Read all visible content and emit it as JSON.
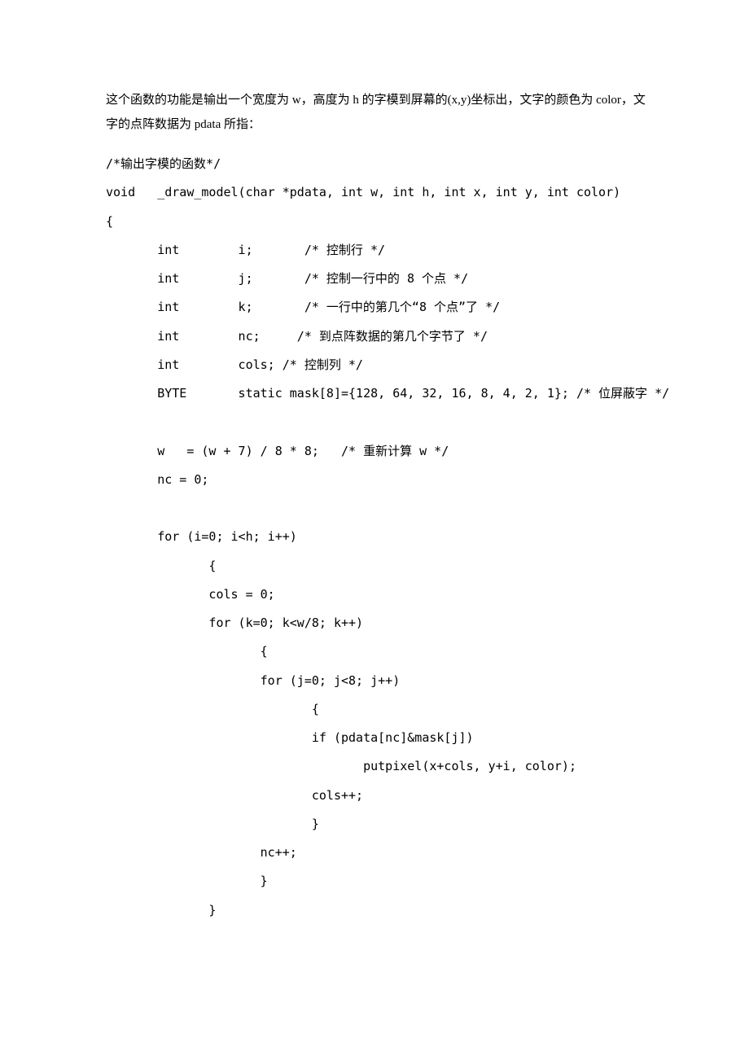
{
  "intro": {
    "p1": "这个函数的功能是输出一个宽度为 w，高度为 h 的字模到屏幕的(x,y)坐标出，文字的颜色为 color，文字的点阵数据为 pdata 所指："
  },
  "code": {
    "l01": "/*输出字模的函数*/",
    "l02": "void   _draw_model(char *pdata, int w, int h, int x, int y, int color)",
    "l03": "{",
    "l04": "       int        i;       /* 控制行 */",
    "l05": "       int        j;       /* 控制一行中的 8 个点 */",
    "l06": "       int        k;       /* 一行中的第几个“8 个点”了 */",
    "l07": "       int        nc;     /* 到点阵数据的第几个字节了 */",
    "l08": "       int        cols; /* 控制列 */",
    "l09": "       BYTE       static mask[8]={128, 64, 32, 16, 8, 4, 2, 1}; /* 位屏蔽字 */",
    "l10": "",
    "l11": "       w   = (w + 7) / 8 * 8;   /* 重新计算 w */",
    "l12": "       nc = 0;",
    "l13": "",
    "l14": "       for (i=0; i<h; i++)",
    "l15": "              {",
    "l16": "              cols = 0;",
    "l17": "              for (k=0; k<w/8; k++)",
    "l18": "                     {",
    "l19": "                     for (j=0; j<8; j++)",
    "l20": "                            {",
    "l21": "                            if (pdata[nc]&mask[j])",
    "l22": "                                   putpixel(x+cols, y+i, color);",
    "l23": "                            cols++;",
    "l24": "                            }",
    "l25": "                     nc++;",
    "l26": "                     }",
    "l27": "              }"
  }
}
